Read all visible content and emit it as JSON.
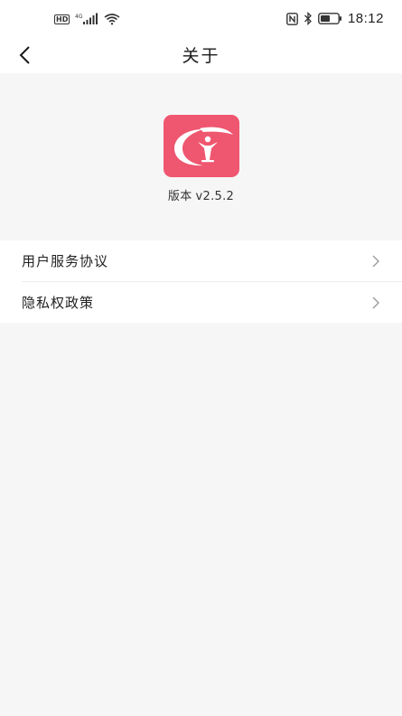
{
  "status_bar": {
    "hd_badge": "HD",
    "network": "4G",
    "icons": [
      "hd-badge-icon",
      "signal-icon",
      "wifi-icon",
      "nfc-icon",
      "bluetooth-icon",
      "battery-icon"
    ],
    "time": "18:12"
  },
  "header": {
    "back_icon": "back-chevron-icon",
    "title": "关于"
  },
  "app": {
    "logo_icon": "app-logo-icon",
    "version_label": "版本",
    "version": "v2.5.2",
    "brand_color": "#ef5670"
  },
  "menu": {
    "items": [
      {
        "label": "用户服务协议",
        "icon": "chevron-right-icon"
      },
      {
        "label": "隐私权政策",
        "icon": "chevron-right-icon"
      }
    ]
  }
}
